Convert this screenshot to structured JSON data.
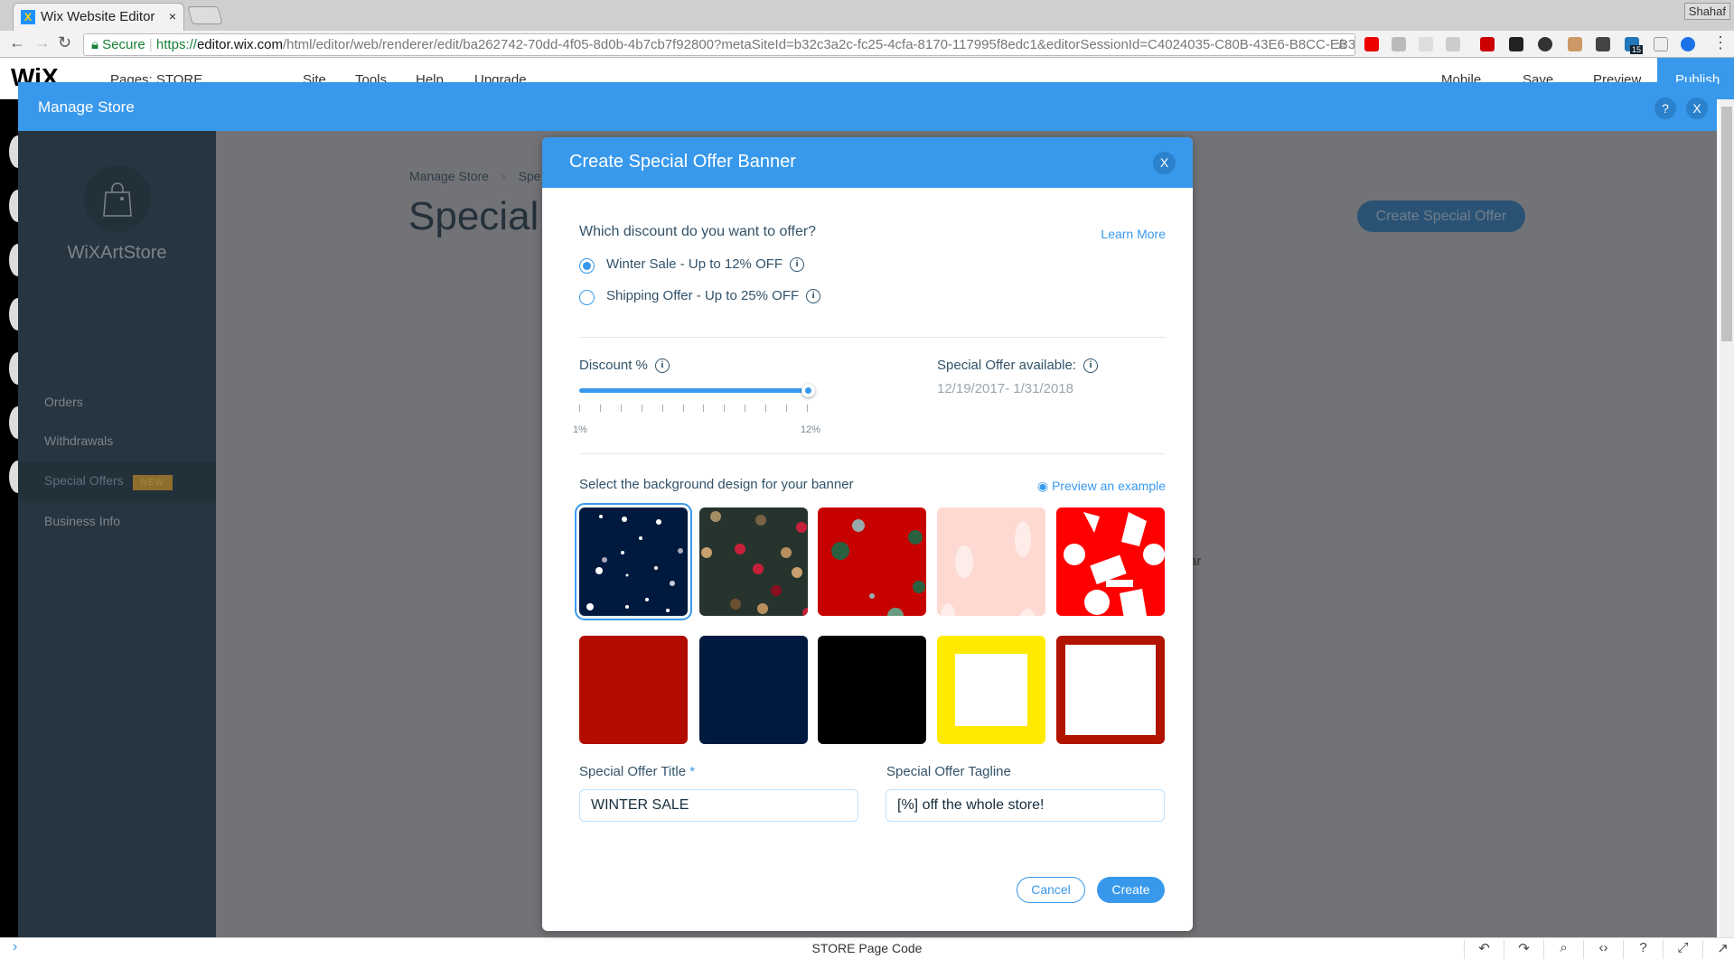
{
  "browser": {
    "tab_title": "Wix Website Editor",
    "user": "Shahaf",
    "secure_label": "Secure",
    "url_scheme": "https://",
    "url_host": "editor.wix.com",
    "url_path": "/html/editor/web/renderer/edit/ba262742-70dd-4f05-8d0b-4b7cb7f92800?metaSiteId=b32c3a2c-fc25-4cfa-8170-117995f8edc1&editorSessionId=C4024035-C80B-43E6-B8CC-EB3...",
    "ext_badge": "15"
  },
  "editor": {
    "logo": "WiX",
    "pages_label": "Pages: STORE",
    "menu": [
      "Site",
      "Tools",
      "Help",
      "Upgrade"
    ],
    "mobile": "Mobile",
    "save": "Save",
    "preview": "Preview",
    "publish": "Publish",
    "page_code": "STORE Page Code"
  },
  "manage": {
    "title": "Manage Store",
    "help": "?",
    "close": "X",
    "brand": "WiXArtStore",
    "sidebar": [
      {
        "label": "Orders"
      },
      {
        "label": "Withdrawals"
      },
      {
        "label": "Special Offers",
        "badge": "NEW",
        "active": true
      },
      {
        "label": "Business Info"
      }
    ],
    "breadcrumb": [
      "Manage Store",
      "Spe"
    ],
    "page_title": "Special O",
    "create_button": "Create Special Offer",
    "partial_text": "ar"
  },
  "modal": {
    "title": "Create Special Offer Banner",
    "close": "X",
    "question": "Which discount do you want to offer?",
    "learn_more": "Learn More",
    "options": [
      {
        "label": "Winter Sale - Up to 12% OFF",
        "selected": true
      },
      {
        "label": "Shipping Offer - Up to 25% OFF",
        "selected": false
      }
    ],
    "discount_label": "Discount %",
    "slider": {
      "min": 1,
      "max": 12,
      "value": 12,
      "min_label": "1%",
      "max_label": "12%"
    },
    "availability_label": "Special Offer available:",
    "availability_dates": "12/19/2017- 1/31/2018",
    "bg_label": "Select the background design for your banner",
    "preview_link": "Preview an example",
    "designs": [
      {
        "name": "snow-navy",
        "selected": true
      },
      {
        "name": "dots-green"
      },
      {
        "name": "confetti-red"
      },
      {
        "name": "pink-brush"
      },
      {
        "name": "shapes-red"
      },
      {
        "name": "solid-red",
        "color": "#b30c00"
      },
      {
        "name": "solid-navy",
        "color": "#001a3f"
      },
      {
        "name": "solid-black",
        "color": "#000000"
      },
      {
        "name": "frame-yellow",
        "color": "#ffea00"
      },
      {
        "name": "frame-red",
        "color": "#b01400"
      }
    ],
    "title_label": "Special Offer Title",
    "required_mark": "*",
    "title_value": "WINTER SALE",
    "tagline_label": "Special Offer Tagline",
    "tagline_value": "[%] off the whole store!",
    "cancel": "Cancel",
    "create": "Create"
  },
  "colors": {
    "accent": "#3899ec",
    "sidebar": "#263540",
    "overlay": "#727376"
  }
}
